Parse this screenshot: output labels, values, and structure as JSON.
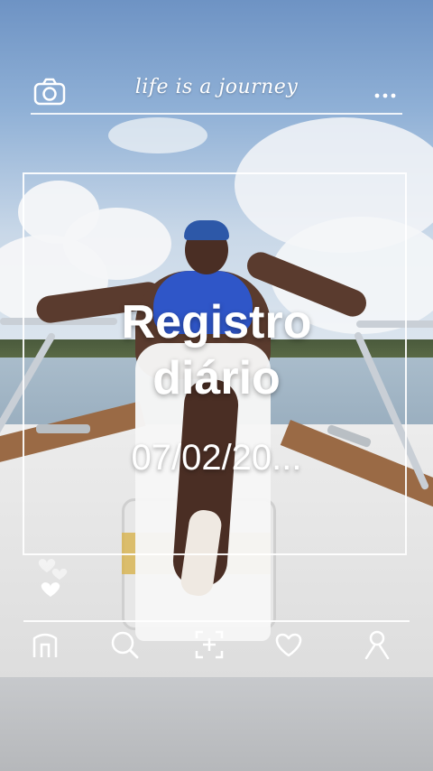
{
  "header": {
    "title": "life is a journey",
    "left_icon": "camera-icon",
    "right_icon": "more-dots-icon"
  },
  "post": {
    "title_line1": "Registro",
    "title_line2": "diário",
    "date": "07/02/20..."
  },
  "reactions": {
    "icon": "hearts-icon"
  },
  "bottom_nav": {
    "items": [
      {
        "icon": "home-icon"
      },
      {
        "icon": "search-icon"
      },
      {
        "icon": "add-icon"
      },
      {
        "icon": "heart-icon"
      },
      {
        "icon": "profile-icon"
      }
    ]
  },
  "colors": {
    "overlay": "#ffffff",
    "sky": "#8fb0d6",
    "swimsuit": "#2f56c8",
    "boat_wood": "#9a6a45"
  }
}
